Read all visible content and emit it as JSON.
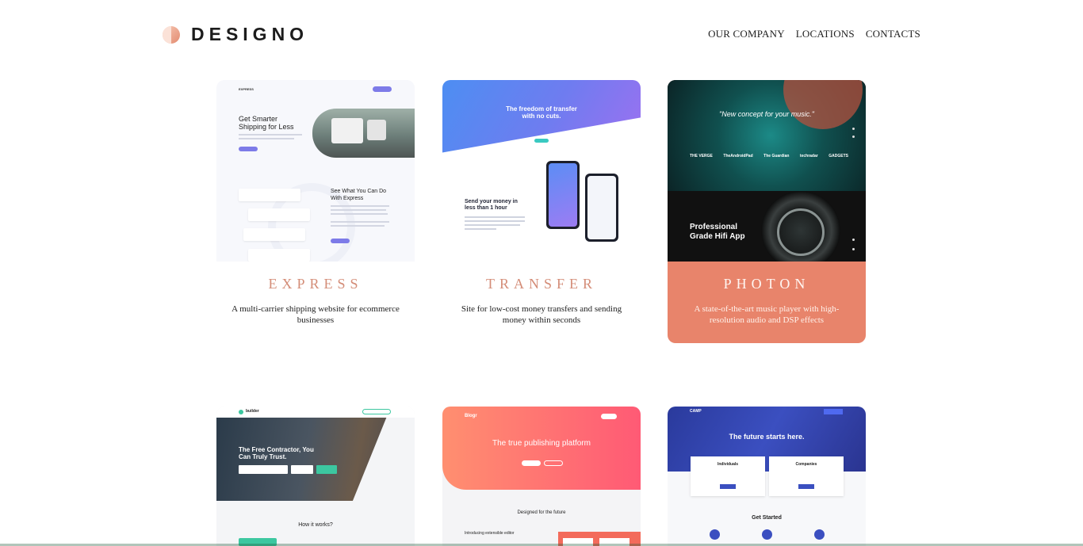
{
  "brand": {
    "name": "DESIGNO",
    "logo_icon": "half-circle-logo-icon"
  },
  "nav": {
    "items": [
      "OUR COMPANY",
      "LOCATIONS",
      "CONTACTS"
    ]
  },
  "colors": {
    "accent": "#d48d78",
    "featured_card": "#e8846b",
    "background": "#ffffff"
  },
  "projects": [
    {
      "title": "EXPRESS",
      "description": "A multi-carrier shipping website for ecommerce businesses",
      "preview": {
        "brand": "EXPRESS",
        "headline": "Get Smarter Shipping for Less",
        "section_heading": "See What You Can Do With Express"
      }
    },
    {
      "title": "TRANSFER",
      "description": "Site for low-cost money transfers and sending money within seconds",
      "preview": {
        "headline": "The freedom of transfer with no cuts.",
        "section_heading": "Send your money in less than 1 hour"
      }
    },
    {
      "title": "PHOTON",
      "description": "A state-of-the-art music player with high-resolution audio and DSP effects",
      "preview": {
        "quote": "\"New concept for your music.\"",
        "press": [
          "THE VERGE",
          "TheAndroidPad",
          "The Guardian",
          "techradar",
          "GADGETS"
        ],
        "section_heading": "Professional Grade Hifi App"
      }
    },
    {
      "preview": {
        "brand": "builder",
        "headline": "The Free Contractor, You Can Truly Trust.",
        "section_heading": "How it works?"
      }
    },
    {
      "preview": {
        "brand": "Blogr",
        "headline": "The true publishing platform",
        "section_heading": "Designed for the future",
        "sub_heading": "Introducing extensible editor"
      }
    },
    {
      "preview": {
        "brand": "CAMP",
        "headline": "The future starts here.",
        "box_1": "Individuals",
        "box_2": "Companies",
        "section_heading": "Get Started"
      }
    }
  ]
}
